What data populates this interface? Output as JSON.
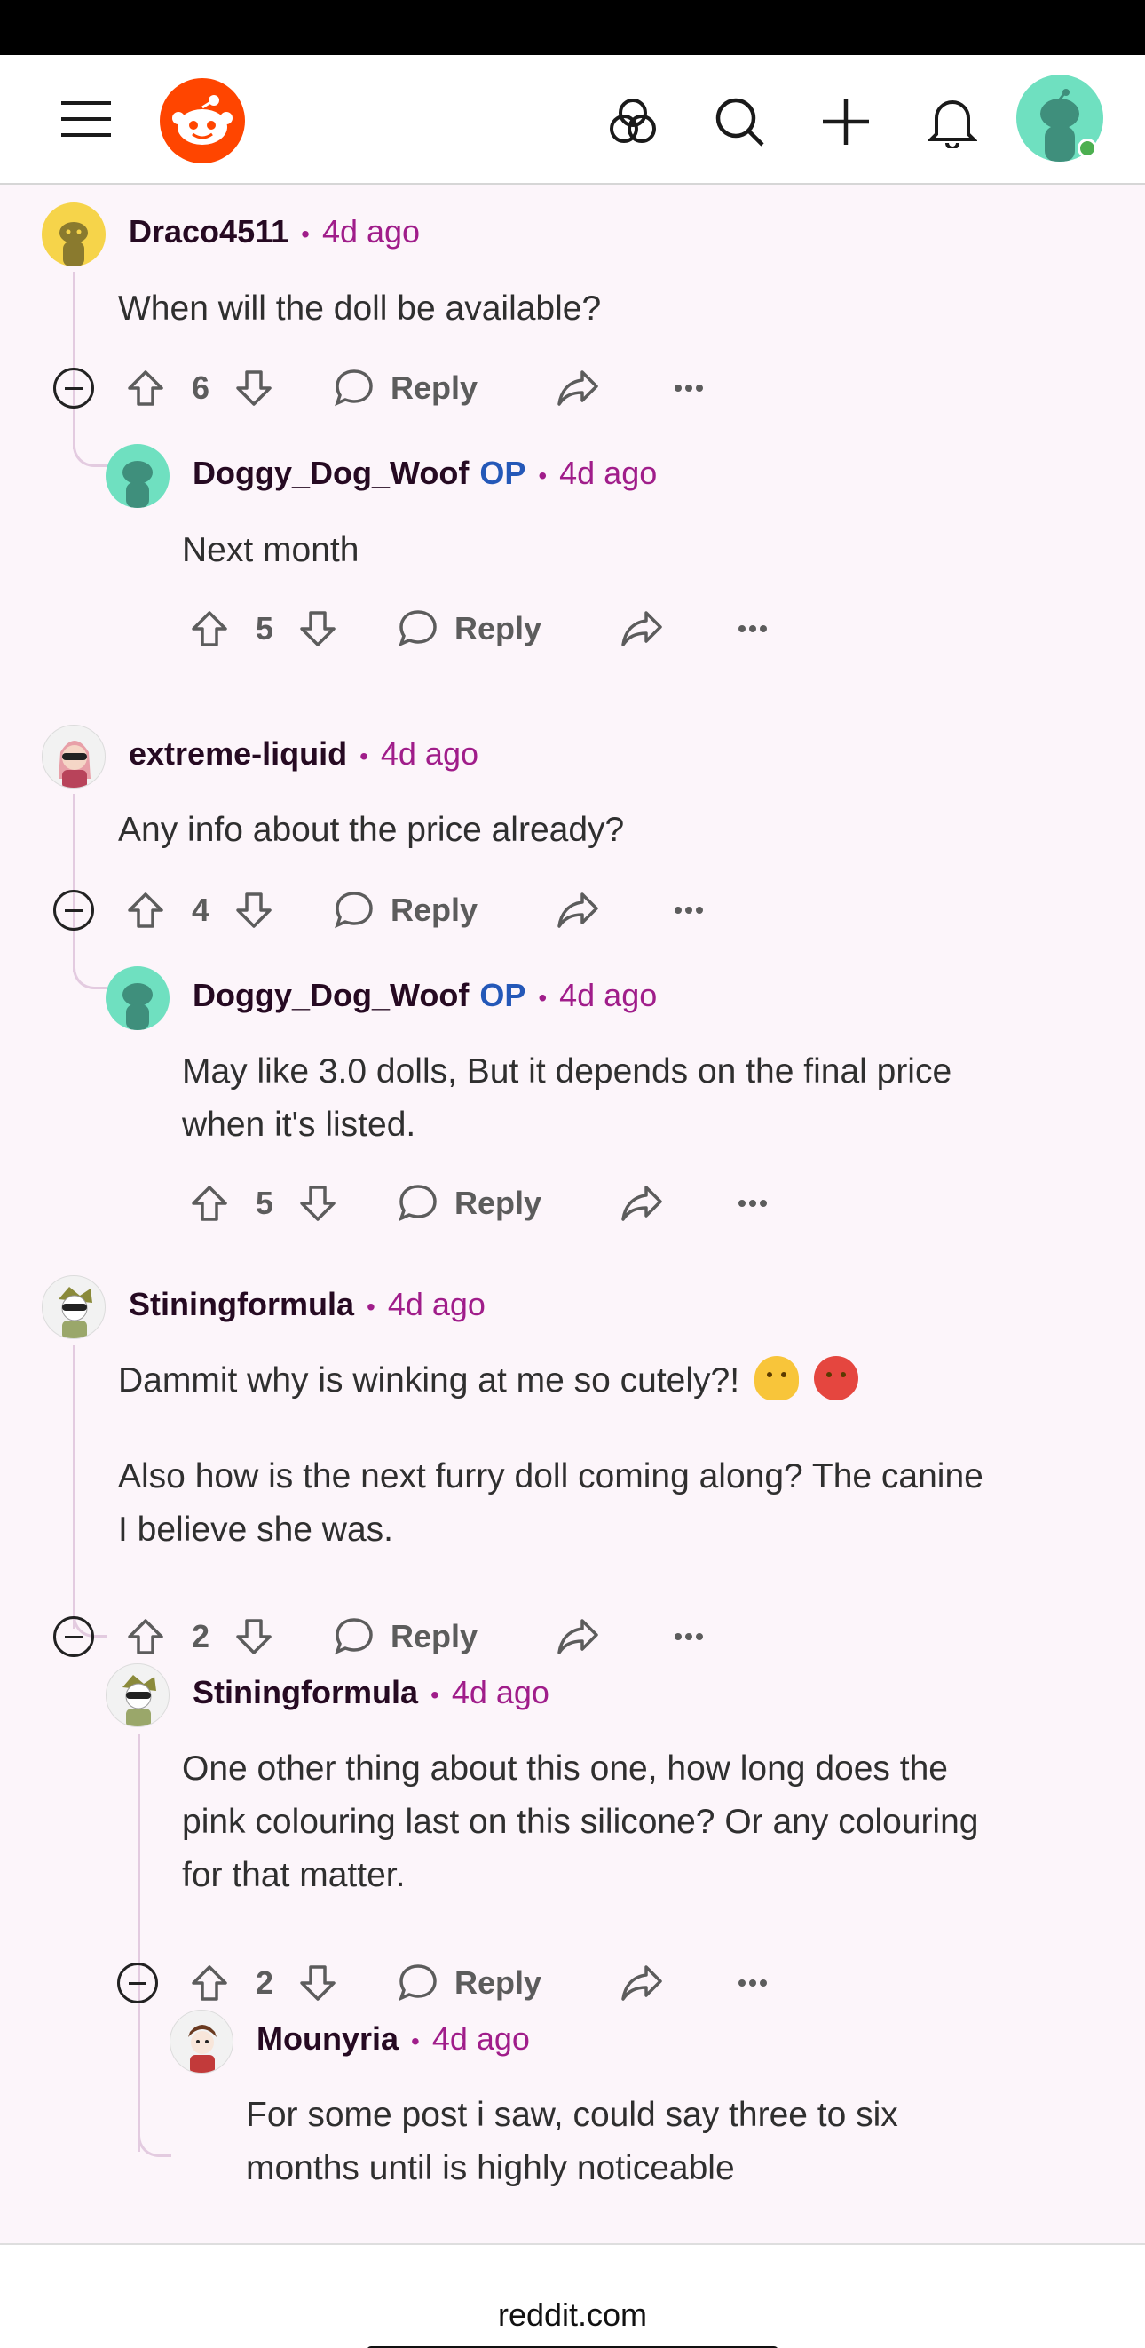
{
  "header": {
    "menu_icon": "hamburger-menu-icon",
    "logo_icon": "reddit-logo-icon",
    "actions": [
      "communities-icon",
      "search-icon",
      "create-post-icon",
      "notifications-bell-icon"
    ],
    "profile_icon": "user-avatar-icon"
  },
  "labels": {
    "reply": "Reply"
  },
  "comments": [
    {
      "author": "Draco4511",
      "time": "4d ago",
      "body": "When will the doll be available?",
      "votes": "6"
    },
    {
      "author": "Doggy_Dog_Woof",
      "op": "OP",
      "time": "4d ago",
      "body": "Next month",
      "votes": "5"
    },
    {
      "author": "extreme-liquid",
      "time": "4d ago",
      "body": "Any info about the price already?",
      "votes": "4"
    },
    {
      "author": "Doggy_Dog_Woof",
      "op": "OP",
      "time": "4d ago",
      "body_lines": [
        "May like 3.0 dolls, But it depends on the final price",
        "when it's listed."
      ],
      "votes": "5"
    },
    {
      "author": "Stiningformula",
      "time": "4d ago",
      "body_line1": "Dammit why is winking at me so cutely?!",
      "emojis": [
        "melting-face-emoji",
        "hot-face-emoji"
      ],
      "body_para2": [
        "Also how is the next furry doll coming along? The canine",
        "I believe she was."
      ],
      "votes": "2"
    },
    {
      "author": "Stiningformula",
      "time": "4d ago",
      "body_lines": [
        "One other thing about this one, how long does the",
        "pink colouring last on this silicone? Or any colouring",
        "for that matter."
      ],
      "votes": "2"
    },
    {
      "author": "Mounyria",
      "time": "4d ago",
      "body_lines": [
        "For some post i saw, could say three to six",
        "months until is highly noticeable"
      ]
    }
  ],
  "browser": {
    "url": "reddit.com"
  },
  "colors": {
    "accent": "#ff4500",
    "time": "#a01d8a",
    "op": "#2458b8",
    "thread_line": "#e3cbe0",
    "background": "#fcf5fa"
  }
}
